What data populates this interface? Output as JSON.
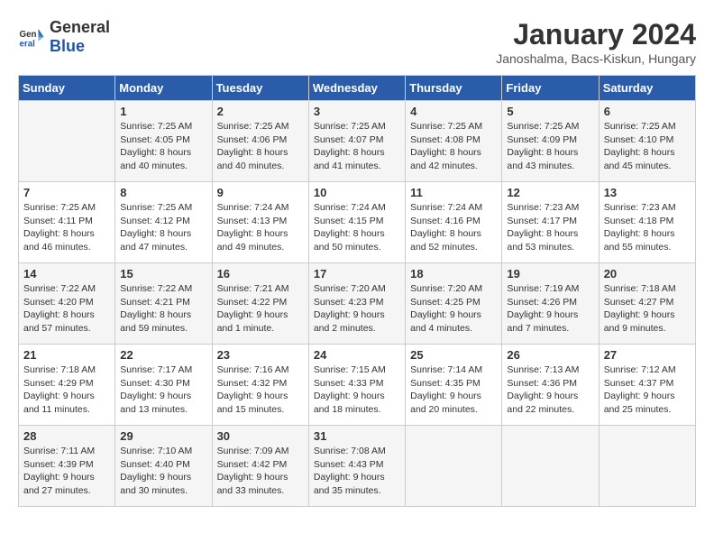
{
  "header": {
    "logo_general": "General",
    "logo_blue": "Blue",
    "month_title": "January 2024",
    "subtitle": "Janoshalma, Bacs-Kiskun, Hungary"
  },
  "days_of_week": [
    "Sunday",
    "Monday",
    "Tuesday",
    "Wednesday",
    "Thursday",
    "Friday",
    "Saturday"
  ],
  "weeks": [
    [
      {
        "day": "",
        "info": ""
      },
      {
        "day": "1",
        "info": "Sunrise: 7:25 AM\nSunset: 4:05 PM\nDaylight: 8 hours\nand 40 minutes."
      },
      {
        "day": "2",
        "info": "Sunrise: 7:25 AM\nSunset: 4:06 PM\nDaylight: 8 hours\nand 40 minutes."
      },
      {
        "day": "3",
        "info": "Sunrise: 7:25 AM\nSunset: 4:07 PM\nDaylight: 8 hours\nand 41 minutes."
      },
      {
        "day": "4",
        "info": "Sunrise: 7:25 AM\nSunset: 4:08 PM\nDaylight: 8 hours\nand 42 minutes."
      },
      {
        "day": "5",
        "info": "Sunrise: 7:25 AM\nSunset: 4:09 PM\nDaylight: 8 hours\nand 43 minutes."
      },
      {
        "day": "6",
        "info": "Sunrise: 7:25 AM\nSunset: 4:10 PM\nDaylight: 8 hours\nand 45 minutes."
      }
    ],
    [
      {
        "day": "7",
        "info": "Sunrise: 7:25 AM\nSunset: 4:11 PM\nDaylight: 8 hours\nand 46 minutes."
      },
      {
        "day": "8",
        "info": "Sunrise: 7:25 AM\nSunset: 4:12 PM\nDaylight: 8 hours\nand 47 minutes."
      },
      {
        "day": "9",
        "info": "Sunrise: 7:24 AM\nSunset: 4:13 PM\nDaylight: 8 hours\nand 49 minutes."
      },
      {
        "day": "10",
        "info": "Sunrise: 7:24 AM\nSunset: 4:15 PM\nDaylight: 8 hours\nand 50 minutes."
      },
      {
        "day": "11",
        "info": "Sunrise: 7:24 AM\nSunset: 4:16 PM\nDaylight: 8 hours\nand 52 minutes."
      },
      {
        "day": "12",
        "info": "Sunrise: 7:23 AM\nSunset: 4:17 PM\nDaylight: 8 hours\nand 53 minutes."
      },
      {
        "day": "13",
        "info": "Sunrise: 7:23 AM\nSunset: 4:18 PM\nDaylight: 8 hours\nand 55 minutes."
      }
    ],
    [
      {
        "day": "14",
        "info": "Sunrise: 7:22 AM\nSunset: 4:20 PM\nDaylight: 8 hours\nand 57 minutes."
      },
      {
        "day": "15",
        "info": "Sunrise: 7:22 AM\nSunset: 4:21 PM\nDaylight: 8 hours\nand 59 minutes."
      },
      {
        "day": "16",
        "info": "Sunrise: 7:21 AM\nSunset: 4:22 PM\nDaylight: 9 hours\nand 1 minute."
      },
      {
        "day": "17",
        "info": "Sunrise: 7:20 AM\nSunset: 4:23 PM\nDaylight: 9 hours\nand 2 minutes."
      },
      {
        "day": "18",
        "info": "Sunrise: 7:20 AM\nSunset: 4:25 PM\nDaylight: 9 hours\nand 4 minutes."
      },
      {
        "day": "19",
        "info": "Sunrise: 7:19 AM\nSunset: 4:26 PM\nDaylight: 9 hours\nand 7 minutes."
      },
      {
        "day": "20",
        "info": "Sunrise: 7:18 AM\nSunset: 4:27 PM\nDaylight: 9 hours\nand 9 minutes."
      }
    ],
    [
      {
        "day": "21",
        "info": "Sunrise: 7:18 AM\nSunset: 4:29 PM\nDaylight: 9 hours\nand 11 minutes."
      },
      {
        "day": "22",
        "info": "Sunrise: 7:17 AM\nSunset: 4:30 PM\nDaylight: 9 hours\nand 13 minutes."
      },
      {
        "day": "23",
        "info": "Sunrise: 7:16 AM\nSunset: 4:32 PM\nDaylight: 9 hours\nand 15 minutes."
      },
      {
        "day": "24",
        "info": "Sunrise: 7:15 AM\nSunset: 4:33 PM\nDaylight: 9 hours\nand 18 minutes."
      },
      {
        "day": "25",
        "info": "Sunrise: 7:14 AM\nSunset: 4:35 PM\nDaylight: 9 hours\nand 20 minutes."
      },
      {
        "day": "26",
        "info": "Sunrise: 7:13 AM\nSunset: 4:36 PM\nDaylight: 9 hours\nand 22 minutes."
      },
      {
        "day": "27",
        "info": "Sunrise: 7:12 AM\nSunset: 4:37 PM\nDaylight: 9 hours\nand 25 minutes."
      }
    ],
    [
      {
        "day": "28",
        "info": "Sunrise: 7:11 AM\nSunset: 4:39 PM\nDaylight: 9 hours\nand 27 minutes."
      },
      {
        "day": "29",
        "info": "Sunrise: 7:10 AM\nSunset: 4:40 PM\nDaylight: 9 hours\nand 30 minutes."
      },
      {
        "day": "30",
        "info": "Sunrise: 7:09 AM\nSunset: 4:42 PM\nDaylight: 9 hours\nand 33 minutes."
      },
      {
        "day": "31",
        "info": "Sunrise: 7:08 AM\nSunset: 4:43 PM\nDaylight: 9 hours\nand 35 minutes."
      },
      {
        "day": "",
        "info": ""
      },
      {
        "day": "",
        "info": ""
      },
      {
        "day": "",
        "info": ""
      }
    ]
  ]
}
